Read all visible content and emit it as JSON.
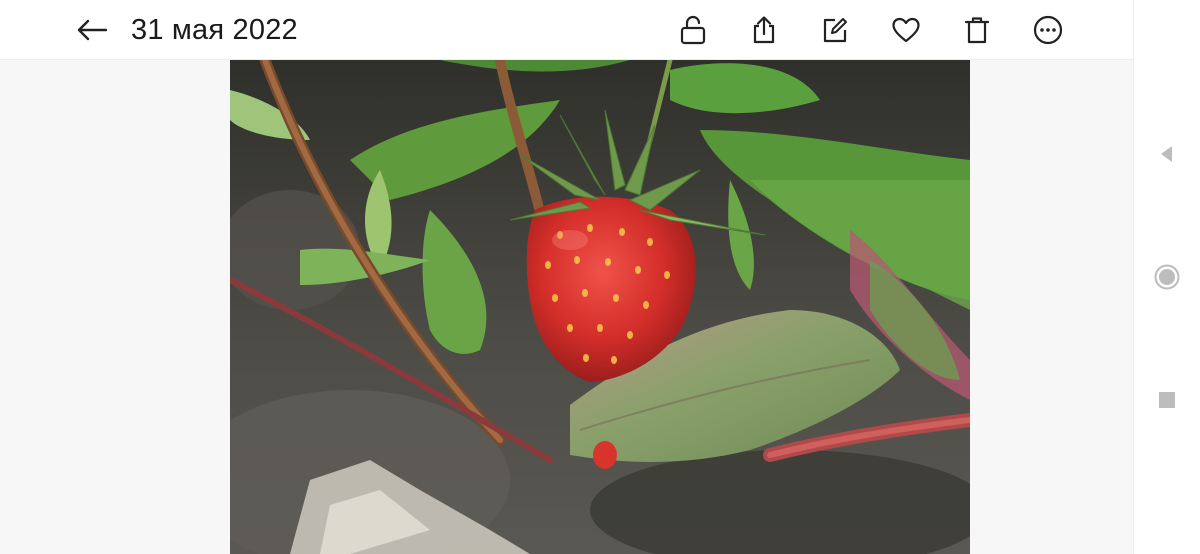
{
  "header": {
    "title": "31 мая 2022",
    "back_icon": "arrow-left-icon",
    "actions": [
      {
        "name": "lock-button",
        "icon": "unlock-icon"
      },
      {
        "name": "share-button",
        "icon": "share-icon"
      },
      {
        "name": "edit-button",
        "icon": "edit-icon"
      },
      {
        "name": "favorite-button",
        "icon": "heart-icon"
      },
      {
        "name": "delete-button",
        "icon": "trash-icon"
      },
      {
        "name": "more-button",
        "icon": "more-horizontal-icon"
      }
    ]
  },
  "photo": {
    "subject": "strawberry-plant-photo"
  },
  "system_nav": {
    "back_icon": "triangle-back-icon",
    "home_icon": "circle-home-icon",
    "recents_icon": "square-recents-icon"
  },
  "colors": {
    "icon": "#222222",
    "title": "#1a1a1a",
    "nav_icon": "#bdbdbd",
    "viewer_bg": "#f7f7f7"
  }
}
